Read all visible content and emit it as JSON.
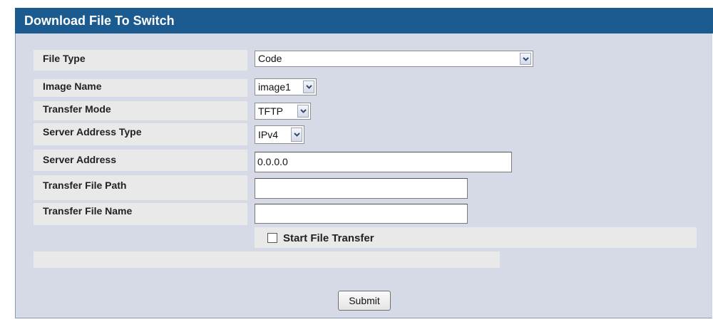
{
  "page": {
    "title": "Download File To Switch"
  },
  "form": {
    "file_type": {
      "label": "File Type",
      "value": "Code"
    },
    "image_name": {
      "label": "Image Name",
      "value": "image1"
    },
    "transfer_mode": {
      "label": "Transfer Mode",
      "value": "TFTP"
    },
    "server_address_type": {
      "label": "Server Address Type",
      "value": "IPv4"
    },
    "server_address": {
      "label": "Server Address",
      "value": "0.0.0.0"
    },
    "transfer_file_path": {
      "label": "Transfer File Path",
      "value": ""
    },
    "transfer_file_name": {
      "label": "Transfer File Name",
      "value": ""
    },
    "start_transfer": {
      "label": "Start File Transfer",
      "checked": false
    }
  },
  "actions": {
    "submit_label": "Submit"
  },
  "colors": {
    "title_bar": "#1b5b8f",
    "panel_bg": "#d6dae6",
    "row_bg": "#e9e9ea"
  },
  "icons": {
    "dropdown": "chevron-down-icon"
  }
}
